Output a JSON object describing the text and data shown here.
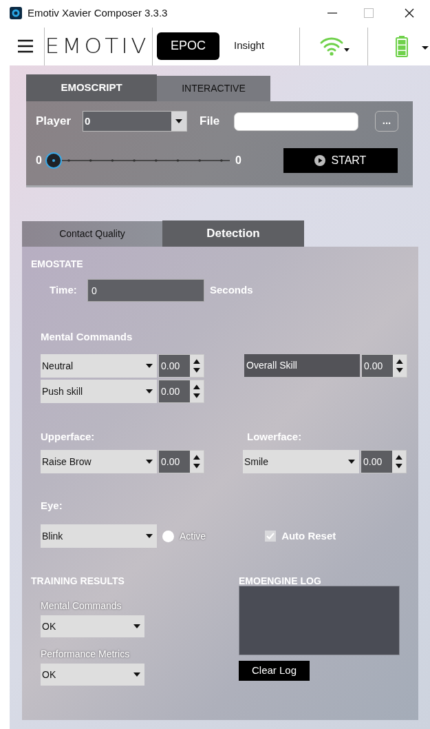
{
  "window": {
    "title": "Emotiv Xavier Composer 3.3.3"
  },
  "toolbar": {
    "logo": "EMOTIV",
    "devices": [
      {
        "label": "EPOC",
        "selected": true
      },
      {
        "label": "Insight",
        "selected": false
      }
    ]
  },
  "script_tabs": [
    {
      "label": "EMOSCRIPT",
      "selected": true
    },
    {
      "label": "INTERACTIVE",
      "selected": false
    }
  ],
  "player": {
    "label": "Player",
    "value": "0",
    "file_label": "File",
    "browse": "...",
    "slider": {
      "min": "0",
      "max": "0"
    },
    "start": "START"
  },
  "detection_tabs": [
    {
      "label": "Contact Quality",
      "selected": false
    },
    {
      "label": "Detection",
      "selected": true
    }
  ],
  "emostate": {
    "title": "EMOSTATE",
    "time_label": "Time:",
    "time_value": "0",
    "unit": "Seconds"
  },
  "mental_commands": {
    "title": "Mental Commands",
    "rows": [
      {
        "value": "Neutral",
        "number": "0.00"
      },
      {
        "value": "Push skill",
        "number": "0.00"
      }
    ],
    "overall": {
      "label": "Overall Skill",
      "number": "0.00"
    }
  },
  "upperface": {
    "title": "Upperface:",
    "value": "Raise Brow",
    "number": "0.00"
  },
  "lowerface": {
    "title": "Lowerface:",
    "value": "Smile",
    "number": "0.00"
  },
  "eye": {
    "title": "Eye:",
    "value": "Blink",
    "active": {
      "label": "Active",
      "checked": false
    },
    "auto_reset": {
      "label": "Auto Reset",
      "checked": true
    }
  },
  "training_results": {
    "title": "TRAINING RESULTS",
    "items": [
      {
        "label": "Mental Commands",
        "value": "OK"
      },
      {
        "label": "Performance Metrics",
        "value": "OK"
      }
    ]
  },
  "log": {
    "title": "EMOENGINE LOG",
    "button": "Clear Log"
  }
}
